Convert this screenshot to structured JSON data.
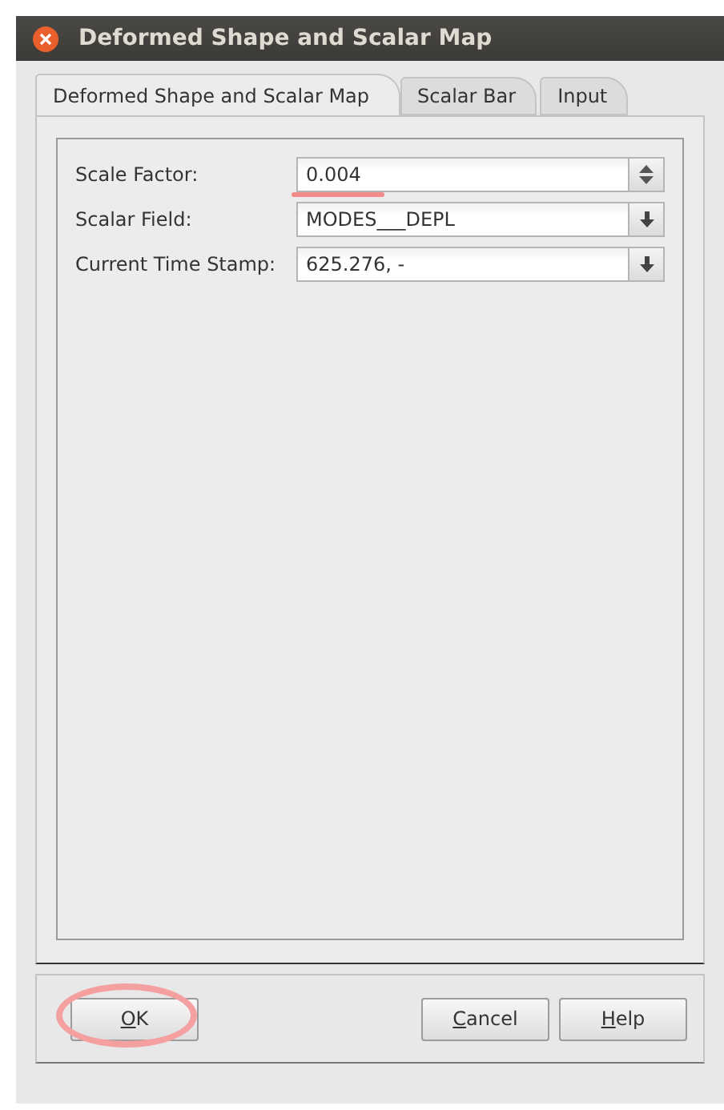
{
  "window": {
    "title": "Deformed Shape and Scalar Map"
  },
  "tabs": [
    {
      "label": "Deformed Shape and Scalar Map",
      "selected": true
    },
    {
      "label": "Scalar Bar",
      "selected": false
    },
    {
      "label": "Input",
      "selected": false
    }
  ],
  "fields": [
    {
      "label": "Scale Factor:",
      "value": "0.004",
      "kind": "spin",
      "underlined": true
    },
    {
      "label": "Scalar Field:",
      "value": "MODES___DEPL",
      "kind": "combo",
      "underlined": false
    },
    {
      "label": "Current Time Stamp:",
      "value": "625.276, -",
      "kind": "combo",
      "underlined": false
    }
  ],
  "buttons": [
    {
      "mnemonic": "O",
      "rest": "K",
      "circled": true
    },
    {
      "mnemonic": "C",
      "rest": "ancel",
      "circled": false
    },
    {
      "mnemonic": "H",
      "rest": "elp",
      "circled": false
    }
  ]
}
